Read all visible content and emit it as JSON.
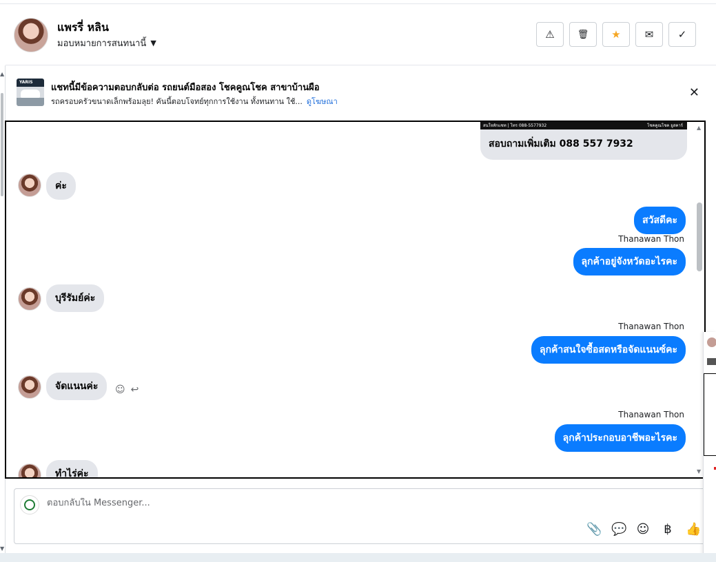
{
  "header": {
    "contact_name": "แพรรี่ หลิน",
    "assign_label": "มอบหมายการสนทนานี้"
  },
  "ad": {
    "thumb_text": "YARIS",
    "title": "แชทนี้มีข้อความตอบกลับต่อ รถยนต์มือสอง โชคคูณโชค สาขาบ้านผือ",
    "subtitle": "รถครอบครัวขนาดเล็กพร้อมลุย! คันนี้ตอบโจทย์ทุกการใช้งาน ทั้งทนทาน ใช้...",
    "link": "ดูโฆษณา"
  },
  "thread": {
    "card": {
      "strip_left": "สนใจทักแชท | โทร 088-5577932",
      "strip_right": "โชคคูณโชค ยูสคาร์",
      "text": "สอบถามเพิ่มเติม 088 557 7932"
    },
    "messages": [
      {
        "dir": "in",
        "text": "ค่ะ"
      },
      {
        "dir": "out",
        "text": "สวัสดีคะ"
      },
      {
        "dir": "sender",
        "text": "Thanawan Thon"
      },
      {
        "dir": "out",
        "text": "ลุกค้าอยู่จังหวัดอะไรคะ"
      },
      {
        "dir": "in",
        "text": "บุรีรัมย์ค่ะ"
      },
      {
        "dir": "sender",
        "text": "Thanawan Thon"
      },
      {
        "dir": "out",
        "text": "ลุกค้าสนใจซื้อสดหรือจัดแนนซ์คะ"
      },
      {
        "dir": "in",
        "text": "จัดแนนค่ะ"
      },
      {
        "dir": "sender",
        "text": "Thanawan Thon"
      },
      {
        "dir": "out",
        "text": "ลุกค้าประกอบอาชีพอะไรคะ"
      },
      {
        "dir": "in",
        "text": "ทำไร่ค่ะ"
      }
    ]
  },
  "composer": {
    "placeholder": "ตอบกลับใน Messenger..."
  },
  "icons": {
    "warn": "⚠",
    "trash": "🗑",
    "star": "★",
    "envelope": "✉",
    "check": "✓",
    "close": "✕",
    "caret": "▼",
    "emoji_small": "☺",
    "reply_small": "↩",
    "attach": "📎",
    "chat": "💬",
    "emoji": "☺",
    "baht": "฿",
    "like": "👍"
  },
  "colors": {
    "accent": "#0a7cff",
    "star": "#f5a623",
    "link": "#216fdb"
  }
}
